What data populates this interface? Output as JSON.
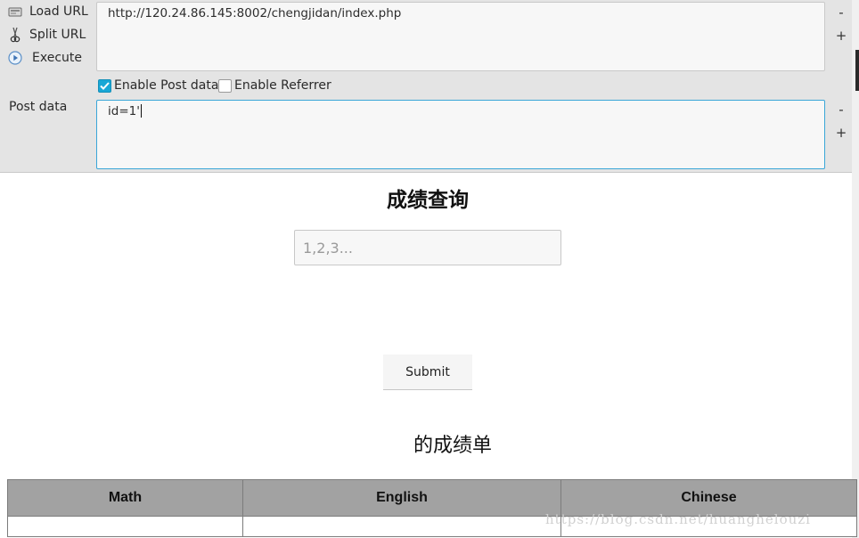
{
  "hackbar": {
    "load_url_label": "Load URL",
    "split_url_label": "Split URL",
    "execute_label": "Execute",
    "url_value": "http://120.24.86.145:8002/chengjidan/index.php",
    "enable_post_label": "Enable Post data",
    "enable_post_checked": true,
    "enable_referrer_label": "Enable Referrer",
    "enable_referrer_checked": false,
    "post_data_label": "Post data",
    "post_data_value": "id=1'",
    "minus": "-",
    "plus": "+"
  },
  "page": {
    "title": "成绩查询",
    "input_placeholder": "1,2,3...",
    "submit_label": "Submit",
    "report_title": "的成绩单",
    "table": {
      "headers": [
        "Math",
        "English",
        "Chinese"
      ],
      "rows": [
        [
          "",
          "",
          ""
        ]
      ]
    }
  },
  "watermark": "https://blog.csdn.net/huanghelouzi"
}
